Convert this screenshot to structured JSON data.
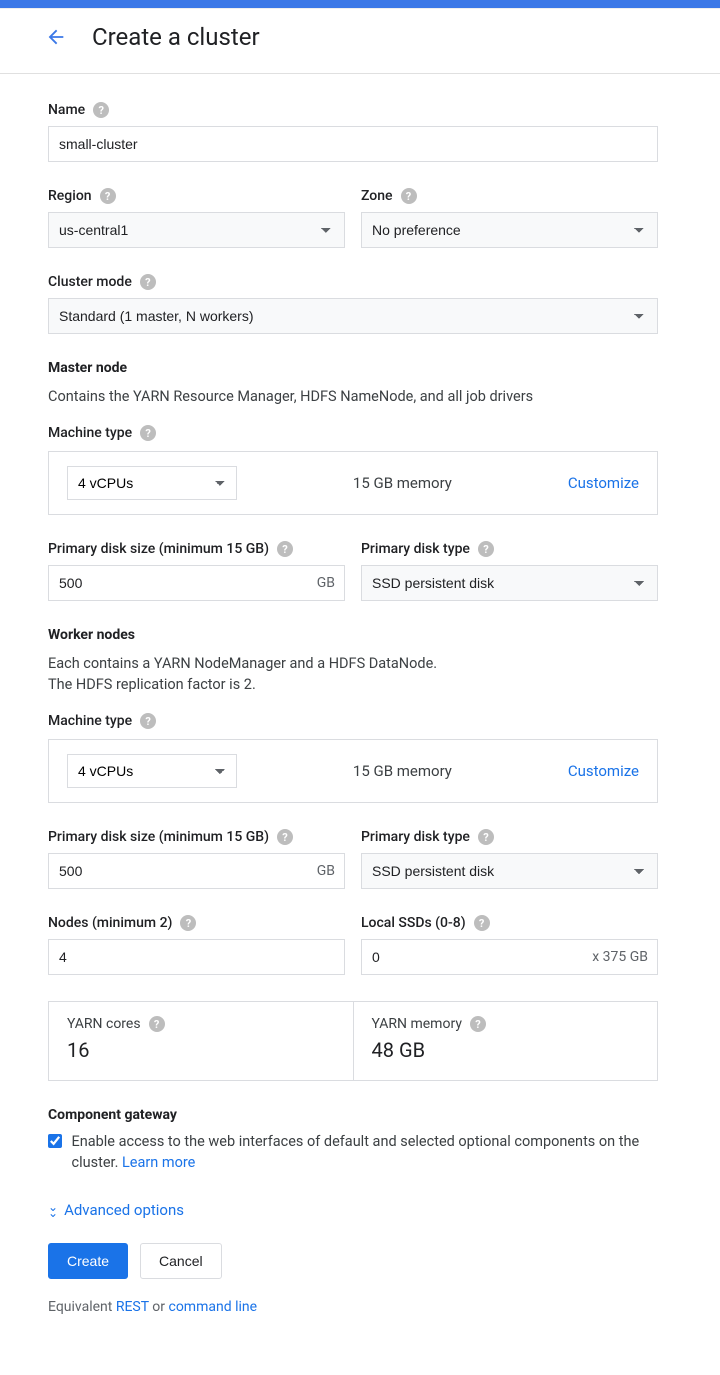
{
  "header": {
    "title": "Create a cluster"
  },
  "name": {
    "label": "Name",
    "value": "small-cluster"
  },
  "region": {
    "label": "Region",
    "value": "us-central1"
  },
  "zone": {
    "label": "Zone",
    "value": "No preference"
  },
  "cluster_mode": {
    "label": "Cluster mode",
    "value": "Standard (1 master, N workers)"
  },
  "master": {
    "title": "Master node",
    "desc": "Contains the YARN Resource Manager, HDFS NameNode, and all job drivers",
    "machine_type_label": "Machine type",
    "cpu_value": "4 vCPUs",
    "memory": "15 GB memory",
    "customize": "Customize",
    "disk_size_label": "Primary disk size (minimum 15 GB)",
    "disk_size_value": "500",
    "disk_size_unit": "GB",
    "disk_type_label": "Primary disk type",
    "disk_type_value": "SSD persistent disk"
  },
  "worker": {
    "title": "Worker nodes",
    "desc_line1": "Each contains a YARN NodeManager and a HDFS DataNode.",
    "desc_line2": "The HDFS replication factor is 2.",
    "machine_type_label": "Machine type",
    "cpu_value": "4 vCPUs",
    "memory": "15 GB memory",
    "customize": "Customize",
    "disk_size_label": "Primary disk size (minimum 15 GB)",
    "disk_size_value": "500",
    "disk_size_unit": "GB",
    "disk_type_label": "Primary disk type",
    "disk_type_value": "SSD persistent disk",
    "nodes_label": "Nodes (minimum 2)",
    "nodes_value": "4",
    "ssds_label": "Local SSDs (0-8)",
    "ssds_value": "0",
    "ssds_suffix": "x 375 GB"
  },
  "yarn": {
    "cores_label": "YARN cores",
    "cores_value": "16",
    "memory_label": "YARN memory",
    "memory_value": "48 GB"
  },
  "component_gateway": {
    "title": "Component gateway",
    "checkbox_checked": true,
    "desc": "Enable access to the web interfaces of default and selected optional components on the cluster. ",
    "learn_more": "Learn more"
  },
  "advanced": {
    "label": "Advanced options"
  },
  "buttons": {
    "create": "Create",
    "cancel": "Cancel"
  },
  "equivalent": {
    "prefix": "Equivalent ",
    "rest": "REST",
    "or": " or ",
    "cmd": "command line"
  }
}
